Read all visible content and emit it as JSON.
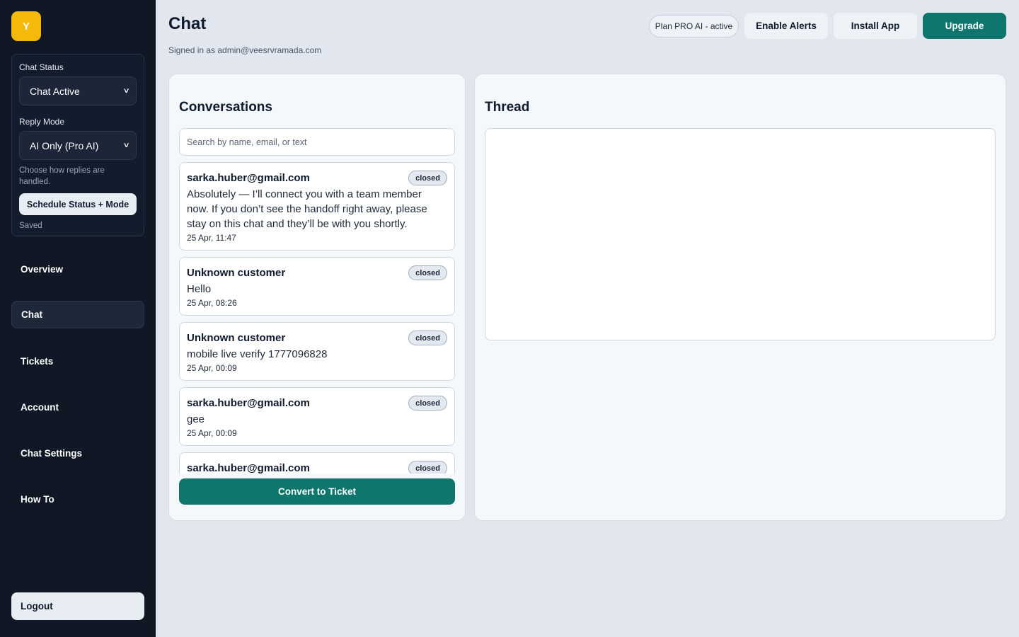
{
  "sidebar": {
    "logo_letter": "Y",
    "chat_status_label": "Chat Status",
    "chat_status_value": "Chat Active",
    "reply_mode_label": "Reply Mode",
    "reply_mode_value": "AI Only (Pro AI)",
    "reply_mode_hint": "Choose how replies are handled.",
    "schedule_button": "Schedule Status + Mode",
    "saved_text": "Saved",
    "nav": [
      {
        "label": "Overview"
      },
      {
        "label": "Chat"
      },
      {
        "label": "Tickets"
      },
      {
        "label": "Account"
      },
      {
        "label": "Chat Settings"
      },
      {
        "label": "How To"
      }
    ],
    "logout": "Logout"
  },
  "header": {
    "title": "Chat",
    "signed_in": "Signed in as admin@veesrvramada.com",
    "plan_pill": "Plan PRO AI - active",
    "enable_alerts": "Enable Alerts",
    "install_app": "Install App",
    "upgrade": "Upgrade"
  },
  "conversations": {
    "title": "Conversations",
    "search_placeholder": "Search by name, email, or text",
    "items": [
      {
        "name": "sarka.huber@gmail.com",
        "message": "Absolutely — I’ll connect you with a team member now. If you don’t see the handoff right away, please stay on this chat and they’ll be with you shortly.",
        "date": "25 Apr, 11:47",
        "status": "closed"
      },
      {
        "name": "Unknown customer",
        "message": "Hello",
        "date": "25 Apr, 08:26",
        "status": "closed"
      },
      {
        "name": "Unknown customer",
        "message": "mobile live verify 1777096828",
        "date": "25 Apr, 00:09",
        "status": "closed"
      },
      {
        "name": "sarka.huber@gmail.com",
        "message": "gee",
        "date": "25 Apr, 00:09",
        "status": "closed"
      },
      {
        "name": "sarka.huber@gmail.com",
        "message": "",
        "date": "",
        "status": "closed"
      }
    ],
    "convert_button": "Convert to Ticket"
  },
  "thread": {
    "title": "Thread"
  },
  "colors": {
    "sidebar_bg": "#101826",
    "accent_teal": "#0f766e",
    "logo_yellow": "#f5b90a",
    "page_bg": "#e2e7ef"
  }
}
